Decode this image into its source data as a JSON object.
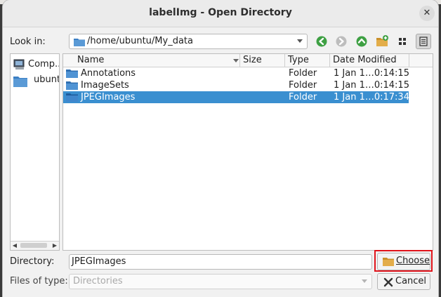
{
  "window": {
    "title": "labelImg - Open Directory",
    "close_glyph": "✕"
  },
  "look_in": {
    "label": "Look in:",
    "path": "/home/ubuntu/My_data"
  },
  "toolbar": {
    "icons": [
      "back-icon",
      "forward-icon",
      "up-directory-icon",
      "new-folder-icon",
      "icon-view-icon",
      "detail-view-icon"
    ]
  },
  "sidebar": {
    "items": [
      {
        "label": "Comp...",
        "icon": "computer-icon"
      },
      {
        "label": "ubunt",
        "icon": "folder-icon"
      }
    ]
  },
  "file_list": {
    "columns": [
      "Name",
      "Size",
      "Type",
      "Date Modified"
    ],
    "rows": [
      {
        "name": "Annotations",
        "size": "",
        "type": "Folder",
        "date": "1 Jan 1…0:14:15",
        "selected": false
      },
      {
        "name": "ImageSets",
        "size": "",
        "type": "Folder",
        "date": "1 Jan 1…0:14:15",
        "selected": false
      },
      {
        "name": "JPEGImages",
        "size": "",
        "type": "Folder",
        "date": "1 Jan 1…0:17:34",
        "selected": true
      }
    ]
  },
  "directory": {
    "label": "Directory:",
    "value": "JPEGImages"
  },
  "files_of_type": {
    "label": "Files of type:",
    "value": "Directories"
  },
  "buttons": {
    "choose": "Choose",
    "cancel": "Cancel"
  },
  "colors": {
    "selection": "#3a8fd0",
    "highlight_border": "#e0141b",
    "folder": "#3b7fc4"
  }
}
